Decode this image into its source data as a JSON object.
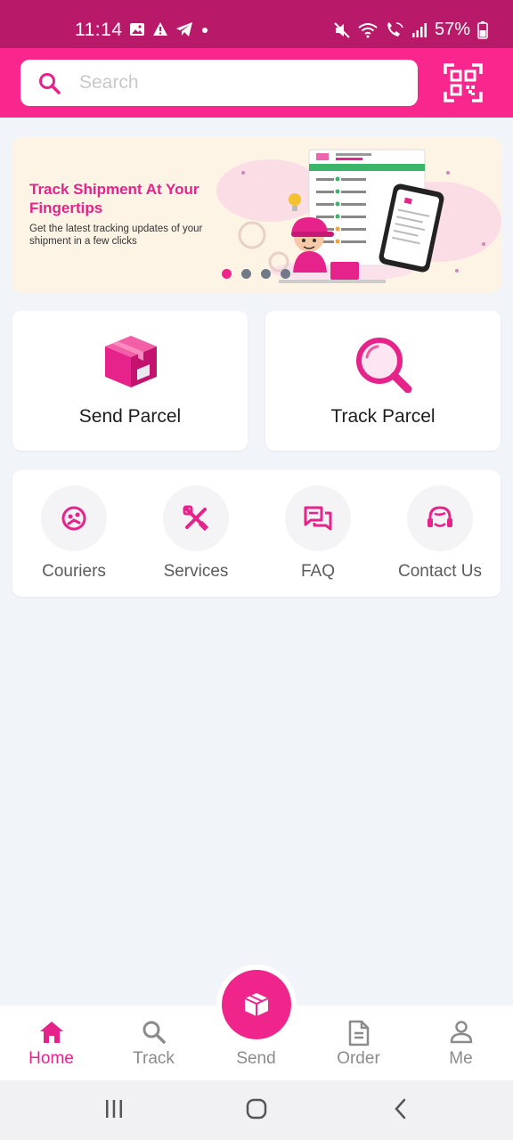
{
  "status_bar": {
    "time": "11:14",
    "battery": "57%",
    "icons": [
      "image-icon",
      "warning-icon",
      "telegram-icon",
      "dot-icon",
      "mute-icon",
      "wifi-icon",
      "wifi-call-icon",
      "signal-icon",
      "battery-icon"
    ]
  },
  "search": {
    "placeholder": "Search",
    "value": ""
  },
  "header": {
    "qr_icon": "qr-scan-icon"
  },
  "banner": {
    "title": "Track Shipment At Your Fingertips",
    "subtitle": "Get the latest tracking updates of your shipment in a few clicks",
    "slides_total": 4,
    "active_slide": 1
  },
  "actions": [
    {
      "label": "Send Parcel",
      "icon": "parcel-box-icon"
    },
    {
      "label": "Track Parcel",
      "icon": "magnifier-icon"
    }
  ],
  "shortcuts": [
    {
      "label": "Couriers",
      "icon": "courier-icon"
    },
    {
      "label": "Services",
      "icon": "tools-icon"
    },
    {
      "label": "FAQ",
      "icon": "chat-icon"
    },
    {
      "label": "Contact Us",
      "icon": "headset-icon"
    }
  ],
  "bottom_nav": [
    {
      "label": "Home",
      "icon": "home-icon",
      "active": true
    },
    {
      "label": "Track",
      "icon": "search-icon",
      "active": false
    },
    {
      "label": "Send",
      "icon": "box-icon",
      "active": false
    },
    {
      "label": "Order",
      "icon": "document-icon",
      "active": false
    },
    {
      "label": "Me",
      "icon": "user-icon",
      "active": false
    }
  ],
  "colors": {
    "brand": "#f8268d",
    "status_bar": "#b81a69",
    "page_bg": "#f1f4f8",
    "inactive_text": "#8b8b8b"
  }
}
